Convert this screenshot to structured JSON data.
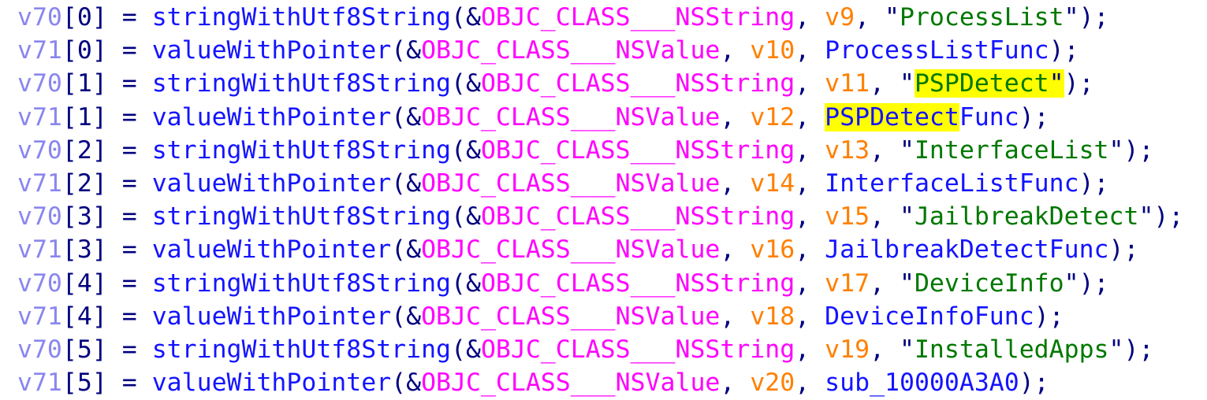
{
  "view": {
    "title": "Decompiler Pseudocode",
    "background_color": "#ffffff",
    "highlight_color": "#ffff00",
    "font_size_px": 31.5,
    "line_height_px": 42.2,
    "visible_line_count": 12,
    "search_term": "PSPDetect"
  },
  "colors": {
    "local_variable": "#8a86ee",
    "punctuation": "#00007f",
    "function_name": "#1414ff",
    "objc_class": "#ff00ff",
    "argument_variable": "#ff8000",
    "string_literal": "#007800",
    "search_highlight": "#ffff00"
  },
  "lines": [
    {
      "index": 0,
      "array": "v70",
      "subscript": "[0]",
      "assign": " = ",
      "call": "stringWithUtf8String",
      "open": "(",
      "amp": "&",
      "objc_class": "OBJC_CLASS___NSString",
      "sep1": ", ",
      "arg": "v9",
      "sep2": ", ",
      "quote_open": "\"",
      "string": "ProcessList",
      "quote_close": "\"",
      "close": ");",
      "highlighted": false
    },
    {
      "index": 1,
      "array": "v71",
      "subscript": "[0]",
      "assign": " = ",
      "call": "valueWithPointer",
      "open": "(",
      "amp": "&",
      "objc_class": "OBJC_CLASS___NSValue",
      "sep1": ", ",
      "arg": "v10",
      "sep2": ", ",
      "symbol": "ProcessListFunc",
      "close": ");",
      "highlighted": false
    },
    {
      "index": 2,
      "array": "v70",
      "subscript": "[1]",
      "assign": " = ",
      "call": "stringWithUtf8String",
      "open": "(",
      "amp": "&",
      "objc_class": "OBJC_CLASS___NSString",
      "sep1": ", ",
      "arg": "v11",
      "sep2": ", ",
      "quote_open": "\"",
      "string": "PSPDetect",
      "quote_close": "\"",
      "close": ");",
      "highlighted": true
    },
    {
      "index": 3,
      "array": "v71",
      "subscript": "[1]",
      "assign": " = ",
      "call": "valueWithPointer",
      "open": "(",
      "amp": "&",
      "objc_class": "OBJC_CLASS___NSValue",
      "sep1": ", ",
      "arg": "v12",
      "sep2": ", ",
      "symbol_hl": "PSPDetect",
      "symbol_rest": "Func",
      "close": ");",
      "highlighted": true
    },
    {
      "index": 4,
      "array": "v70",
      "subscript": "[2]",
      "assign": " = ",
      "call": "stringWithUtf8String",
      "open": "(",
      "amp": "&",
      "objc_class": "OBJC_CLASS___NSString",
      "sep1": ", ",
      "arg": "v13",
      "sep2": ", ",
      "quote_open": "\"",
      "string": "InterfaceList",
      "quote_close": "\"",
      "close": ");",
      "highlighted": false
    },
    {
      "index": 5,
      "array": "v71",
      "subscript": "[2]",
      "assign": " = ",
      "call": "valueWithPointer",
      "open": "(",
      "amp": "&",
      "objc_class": "OBJC_CLASS___NSValue",
      "sep1": ", ",
      "arg": "v14",
      "sep2": ", ",
      "symbol": "InterfaceListFunc",
      "close": ");",
      "highlighted": false
    },
    {
      "index": 6,
      "array": "v70",
      "subscript": "[3]",
      "assign": " = ",
      "call": "stringWithUtf8String",
      "open": "(",
      "amp": "&",
      "objc_class": "OBJC_CLASS___NSString",
      "sep1": ", ",
      "arg": "v15",
      "sep2": ", ",
      "quote_open": "\"",
      "string": "JailbreakDetect",
      "quote_close": "\"",
      "close": ");",
      "highlighted": false
    },
    {
      "index": 7,
      "array": "v71",
      "subscript": "[3]",
      "assign": " = ",
      "call": "valueWithPointer",
      "open": "(",
      "amp": "&",
      "objc_class": "OBJC_CLASS___NSValue",
      "sep1": ", ",
      "arg": "v16",
      "sep2": ", ",
      "symbol": "JailbreakDetectFunc",
      "close": ");",
      "highlighted": false
    },
    {
      "index": 8,
      "array": "v70",
      "subscript": "[4]",
      "assign": " = ",
      "call": "stringWithUtf8String",
      "open": "(",
      "amp": "&",
      "objc_class": "OBJC_CLASS___NSString",
      "sep1": ", ",
      "arg": "v17",
      "sep2": ", ",
      "quote_open": "\"",
      "string": "DeviceInfo",
      "quote_close": "\"",
      "close": ");",
      "highlighted": false
    },
    {
      "index": 9,
      "array": "v71",
      "subscript": "[4]",
      "assign": " = ",
      "call": "valueWithPointer",
      "open": "(",
      "amp": "&",
      "objc_class": "OBJC_CLASS___NSValue",
      "sep1": ", ",
      "arg": "v18",
      "sep2": ", ",
      "symbol": "DeviceInfoFunc",
      "close": ");",
      "highlighted": false
    },
    {
      "index": 10,
      "array": "v70",
      "subscript": "[5]",
      "assign": " = ",
      "call": "stringWithUtf8String",
      "open": "(",
      "amp": "&",
      "objc_class": "OBJC_CLASS___NSString",
      "sep1": ", ",
      "arg": "v19",
      "sep2": ", ",
      "quote_open": "\"",
      "string": "InstalledApps",
      "quote_close": "\"",
      "close": ");",
      "highlighted": false
    },
    {
      "index": 11,
      "array": "v71",
      "subscript": "[5]",
      "assign": " = ",
      "call": "valueWithPointer",
      "open": "(",
      "amp": "&",
      "objc_class": "OBJC_CLASS___NSValue",
      "sep1": ", ",
      "arg": "v20",
      "sep2": ", ",
      "symbol": "sub_10000A3A0",
      "close": ");",
      "highlighted": false
    }
  ]
}
